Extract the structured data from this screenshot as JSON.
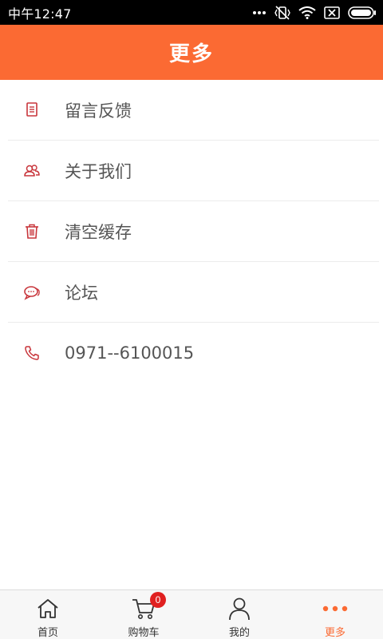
{
  "status_bar": {
    "time": "中午12:47",
    "icons": [
      "more-dots-icon",
      "vibrate-icon",
      "wifi-icon",
      "no-sim-icon",
      "battery-icon"
    ]
  },
  "header": {
    "title": "更多"
  },
  "menu": [
    {
      "label": "留言反馈",
      "icon": "document-icon"
    },
    {
      "label": "关于我们",
      "icon": "users-icon"
    },
    {
      "label": "清空缓存",
      "icon": "trash-icon"
    },
    {
      "label": "论坛",
      "icon": "chat-bubbles-icon"
    },
    {
      "label": "0971--6100015",
      "icon": "phone-icon"
    }
  ],
  "tabbar": {
    "tabs": [
      {
        "label": "首页",
        "icon": "home-icon"
      },
      {
        "label": "购物车",
        "icon": "cart-icon",
        "badge": "0"
      },
      {
        "label": "我的",
        "icon": "person-icon"
      },
      {
        "label": "更多",
        "icon": "more-dots-icon",
        "active": true
      }
    ]
  },
  "colors": {
    "accent": "#fb6a33",
    "icon_red": "#c8353b",
    "badge": "#e02020",
    "text": "#555555"
  }
}
